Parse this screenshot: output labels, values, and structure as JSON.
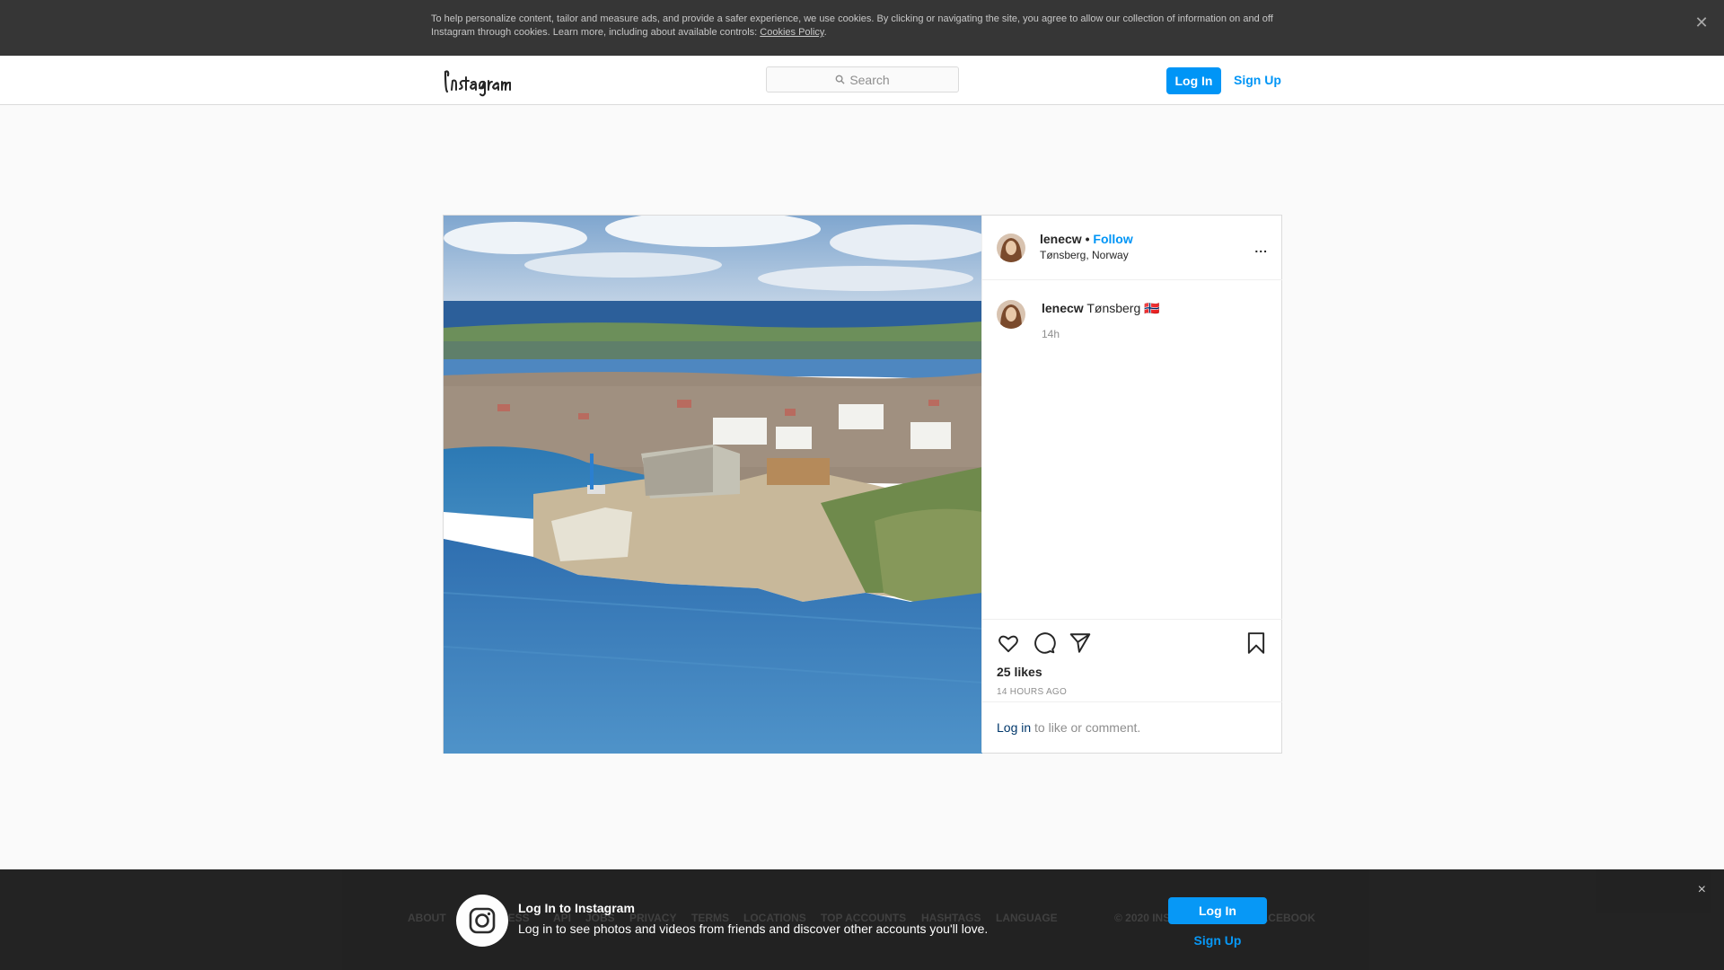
{
  "cookie": {
    "text": "To help personalize content, tailor and measure ads, and provide a safer experience, we use cookies. By clicking or navigating the site, you agree to allow our collection of information on and off Instagram through cookies. Learn more, including about available controls: ",
    "link": "Cookies Policy",
    "suffix": "."
  },
  "nav": {
    "search_placeholder": "Search",
    "login_label": "Log In",
    "signup_label": "Sign Up"
  },
  "post": {
    "username": "lenecw",
    "separator": " • ",
    "follow_label": "Follow",
    "location": "Tønsberg, Norway",
    "more_label": "...",
    "caption_user": "lenecw",
    "caption_text": " Tønsberg 🇳🇴",
    "caption_time": "14h",
    "likes": "25 likes",
    "time_ago": "14 HOURS AGO",
    "login_link": "Log in",
    "login_suffix": " to like or comment."
  },
  "footer": {
    "links": [
      "ABOUT",
      "PRESS",
      "API",
      "JOBS",
      "PRIVACY",
      "TERMS",
      "LOCATIONS",
      "TOP ACCOUNTS",
      "HASHTAGS",
      "LANGUAGE"
    ],
    "copyright": "© 2020 INSTAGRAM FROM FACEBOOK"
  },
  "loginbar": {
    "title": "Log In to Instagram",
    "subtitle": "Log in to see photos and videos from friends and discover other accounts you'll love.",
    "login_label": "Log In",
    "signup_label": "Sign Up",
    "close_label": "×"
  },
  "colors": {
    "accent": "#0095f6",
    "link_dark": "#00376b",
    "cookie_bg": "#363636",
    "loginbar_bg": "#1c1c1c"
  }
}
